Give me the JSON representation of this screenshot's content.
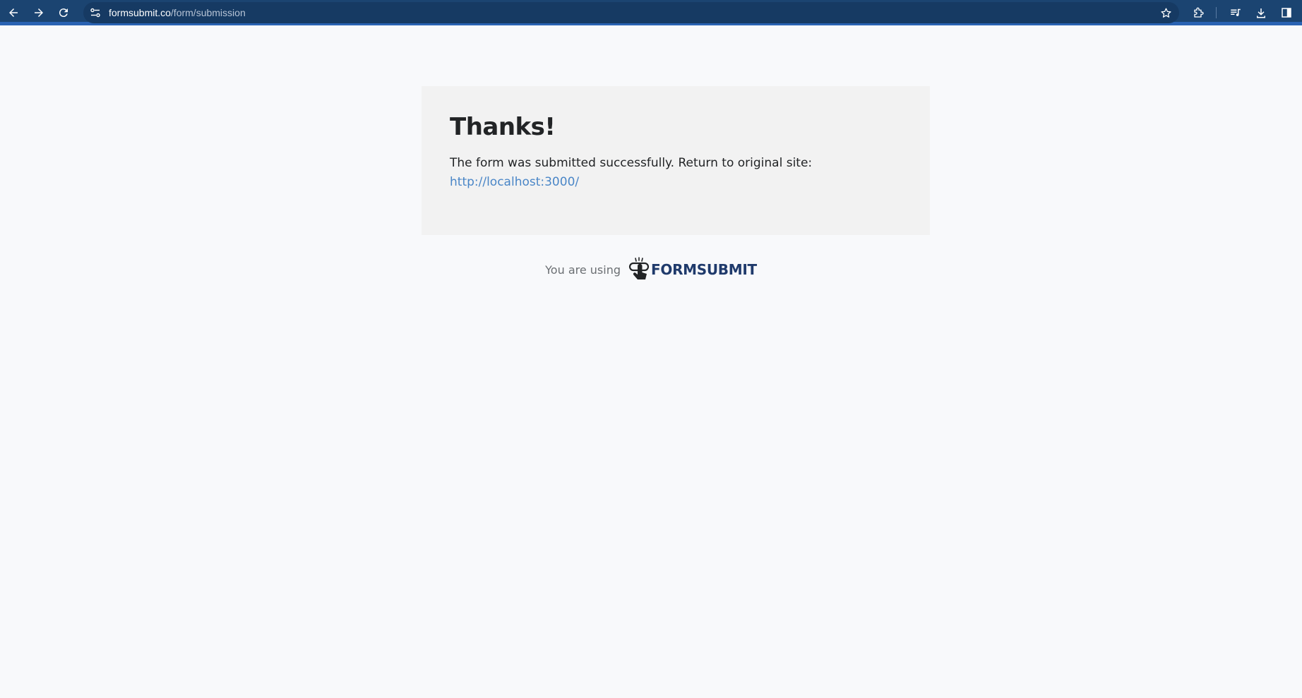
{
  "browser": {
    "url_domain": "formsubmit.co",
    "url_path": "/form/submission",
    "icons": [
      "back-arrow-icon",
      "forward-arrow-icon",
      "reload-icon",
      "site-info-icon",
      "bookmark-star-icon",
      "extensions-icon",
      "media-controls-icon",
      "download-icon",
      "side-panel-icon"
    ],
    "colors": {
      "toolbar": "#1b4471",
      "omnibox": "#163a63"
    }
  },
  "card": {
    "title": "Thanks!",
    "message": "The form was submitted successfully. Return to original site:",
    "link_text": "http://localhost:3000/"
  },
  "footer": {
    "using_text": "You are using",
    "brand_name": "FORMSUBMIT",
    "brand_icon": "hand-pointer-logo-icon"
  },
  "colors": {
    "page_bg": "#f8f9fb",
    "card_bg": "#f2f2f2",
    "link": "#4a86c7",
    "brand": "#1f3a6b"
  }
}
